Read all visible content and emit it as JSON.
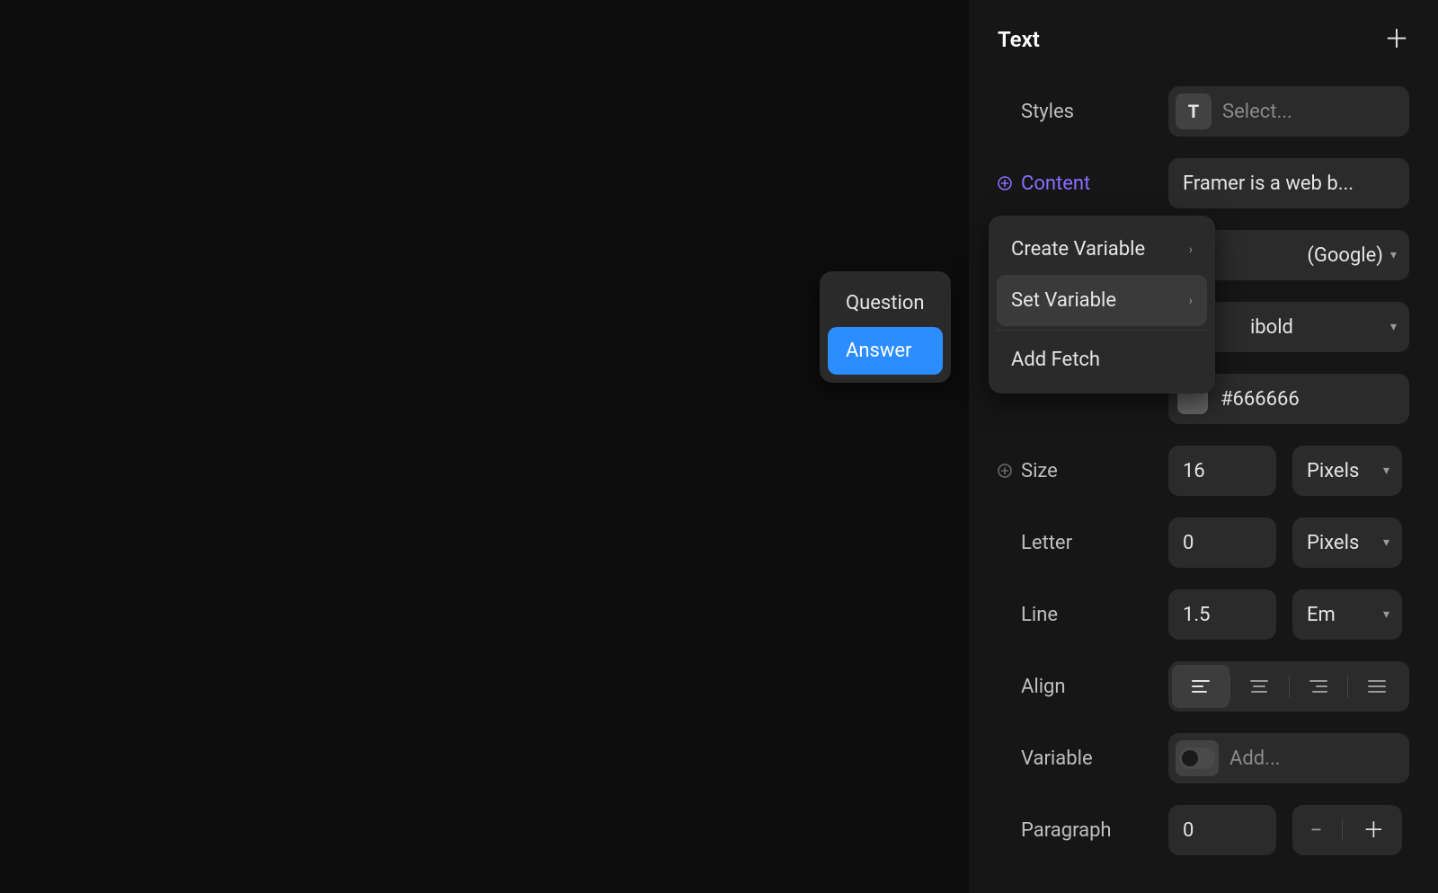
{
  "popup": {
    "items": [
      "Question",
      "Answer"
    ],
    "selected_index": 1
  },
  "context_menu": {
    "items": [
      {
        "label": "Create Variable",
        "has_submenu": true
      },
      {
        "label": "Set Variable",
        "has_submenu": true,
        "hover": true
      },
      {
        "separator": true
      },
      {
        "label": "Add Fetch",
        "has_submenu": false
      }
    ]
  },
  "panel": {
    "title": "Text",
    "styles": {
      "label": "Styles",
      "placeholder": "Select..."
    },
    "content": {
      "label": "Content",
      "value": "Framer is a web b..."
    },
    "font": {
      "value": "(Google)"
    },
    "weight": {
      "value": "ibold"
    },
    "color": {
      "hex": "#666666"
    },
    "size": {
      "label": "Size",
      "value": "16",
      "unit": "Pixels"
    },
    "letter": {
      "label": "Letter",
      "value": "0",
      "unit": "Pixels"
    },
    "line": {
      "label": "Line",
      "value": "1.5",
      "unit": "Em"
    },
    "align": {
      "label": "Align",
      "selected": 0
    },
    "variable": {
      "label": "Variable",
      "placeholder": "Add..."
    },
    "paragraph": {
      "label": "Paragraph",
      "value": "0"
    }
  }
}
